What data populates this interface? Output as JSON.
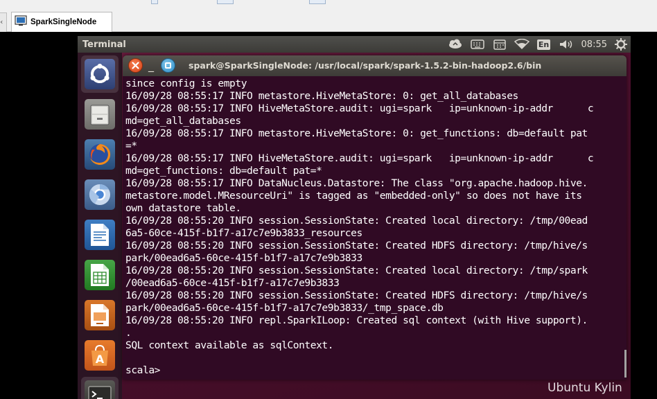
{
  "host": {
    "tab_label": "SparkSingleNode",
    "left_tab_glyph": "‹"
  },
  "panel": {
    "app_title": "Terminal",
    "language": "En",
    "clock": "08:55",
    "indicators": [
      "sync-icon",
      "keyboard-icon",
      "calendar-icon",
      "wifi-icon",
      "language-indicator",
      "volume-icon",
      "clock",
      "gear-icon"
    ]
  },
  "launcher": {
    "items": [
      "ubuntu-kylin-dash-icon",
      "file-manager-icon",
      "firefox-icon",
      "chromium-icon",
      "writer-icon",
      "calc-icon",
      "impress-icon",
      "software-center-icon",
      "terminal-icon"
    ]
  },
  "window": {
    "title": "spark@SparkSingleNode: /usr/local/spark/spark-1.5.2-bin-hadoop2.6/bin",
    "minimize_glyph": "_"
  },
  "terminal": {
    "lines": [
      "since config is empty",
      "16/09/28 08:55:17 INFO metastore.HiveMetaStore: 0: get_all_databases",
      "16/09/28 08:55:17 INFO HiveMetaStore.audit: ugi=spark   ip=unknown-ip-addr      c",
      "md=get_all_databases",
      "16/09/28 08:55:17 INFO metastore.HiveMetaStore: 0: get_functions: db=default pat",
      "=*",
      "16/09/28 08:55:17 INFO HiveMetaStore.audit: ugi=spark   ip=unknown-ip-addr      c",
      "md=get_functions: db=default pat=*",
      "16/09/28 08:55:17 INFO DataNucleus.Datastore: The class \"org.apache.hadoop.hive.",
      "metastore.model.MResourceUri\" is tagged as \"embedded-only\" so does not have its",
      "own datastore table.",
      "16/09/28 08:55:20 INFO session.SessionState: Created local directory: /tmp/00ead",
      "6a5-60ce-415f-b1f7-a17c7e9b3833_resources",
      "16/09/28 08:55:20 INFO session.SessionState: Created HDFS directory: /tmp/hive/s",
      "park/00ead6a5-60ce-415f-b1f7-a17c7e9b3833",
      "16/09/28 08:55:20 INFO session.SessionState: Created local directory: /tmp/spark",
      "/00ead6a5-60ce-415f-b1f7-a17c7e9b3833",
      "16/09/28 08:55:20 INFO session.SessionState: Created HDFS directory: /tmp/hive/s",
      "park/00ead6a5-60ce-415f-b1f7-a17c7e9b3833/_tmp_space.db",
      "16/09/28 08:55:20 INFO repl.SparkILoop: Created sql context (with Hive support).",
      ".",
      "SQL context available as sqlContext.",
      "",
      "scala>"
    ]
  },
  "desktop": {
    "watermark": "Ubuntu Kylin"
  },
  "colors": {
    "terminal_bg": "#300a24",
    "panel_bg": "#3c3b37",
    "close_button": "#e1572b",
    "maximize_button": "#3399d6"
  }
}
